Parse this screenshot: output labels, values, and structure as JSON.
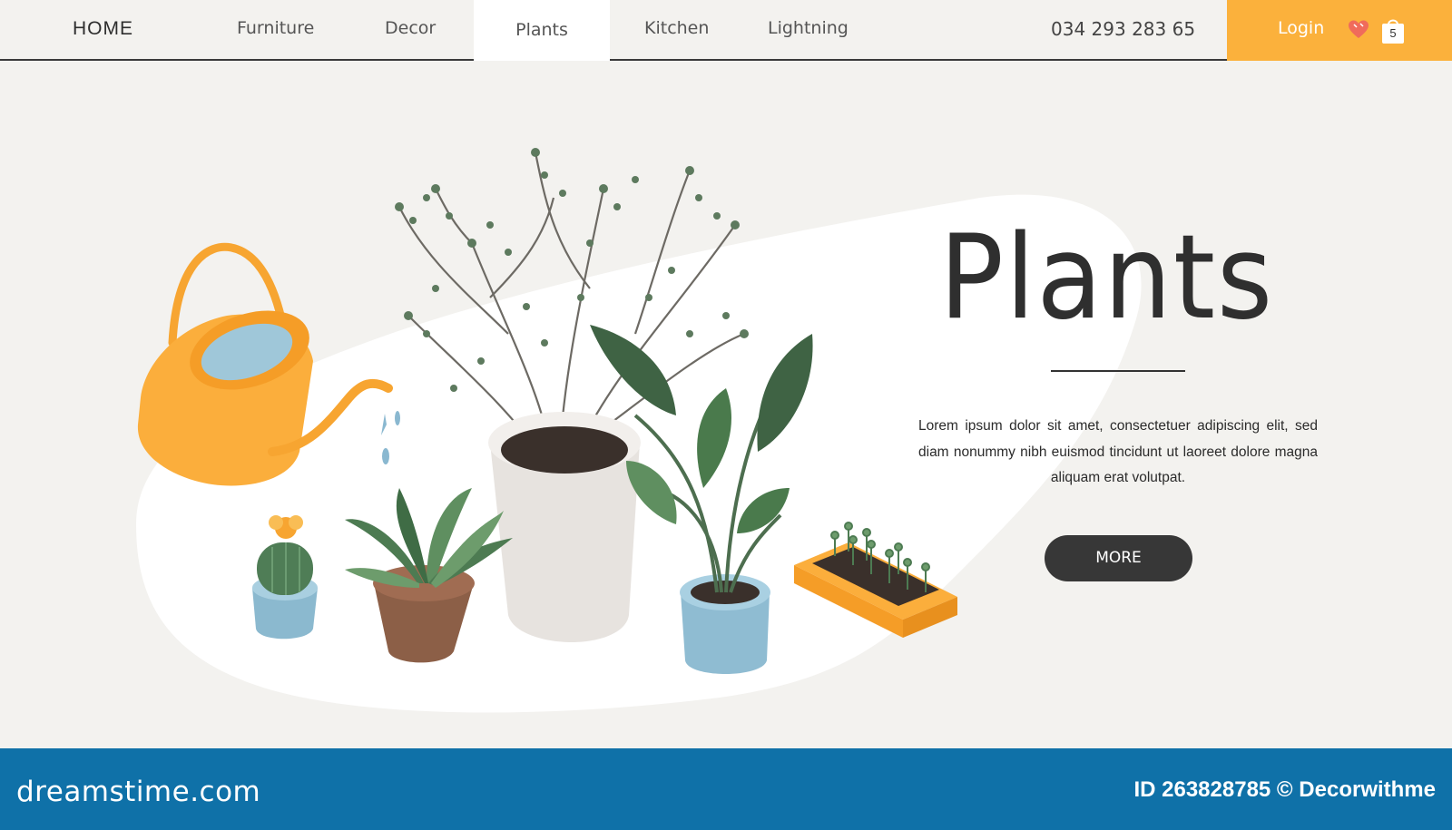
{
  "nav": {
    "home_label": "HOME",
    "items": [
      {
        "label": "Furniture"
      },
      {
        "label": "Decor"
      },
      {
        "label": "Plants"
      },
      {
        "label": "Kitchen"
      },
      {
        "label": "Lightning"
      }
    ],
    "active_item": "Plants",
    "phone": "034 293 283 65",
    "login_label": "Login",
    "cart_count": "5",
    "heart_icon": "heart-icon",
    "bag_icon": "shopping-bag-icon"
  },
  "hero": {
    "title": "Plants",
    "description": "Lorem ipsum dolor sit amet, consectetuer adipiscing elit, sed diam nonummy nibh euismod tincidunt ut laoreet dolore magna aliquam erat volutpat.",
    "more_label": "MORE"
  },
  "footer": {
    "logo": "dreamstime.com",
    "image_credit": "ID 263828785 © Decorwithme"
  },
  "colors": {
    "accent_orange": "#fbb13c",
    "background": "#f3f2ef",
    "button_dark": "#373737",
    "footer_blue": "#0f71a8",
    "leaf_green": "#4e7a4f"
  }
}
